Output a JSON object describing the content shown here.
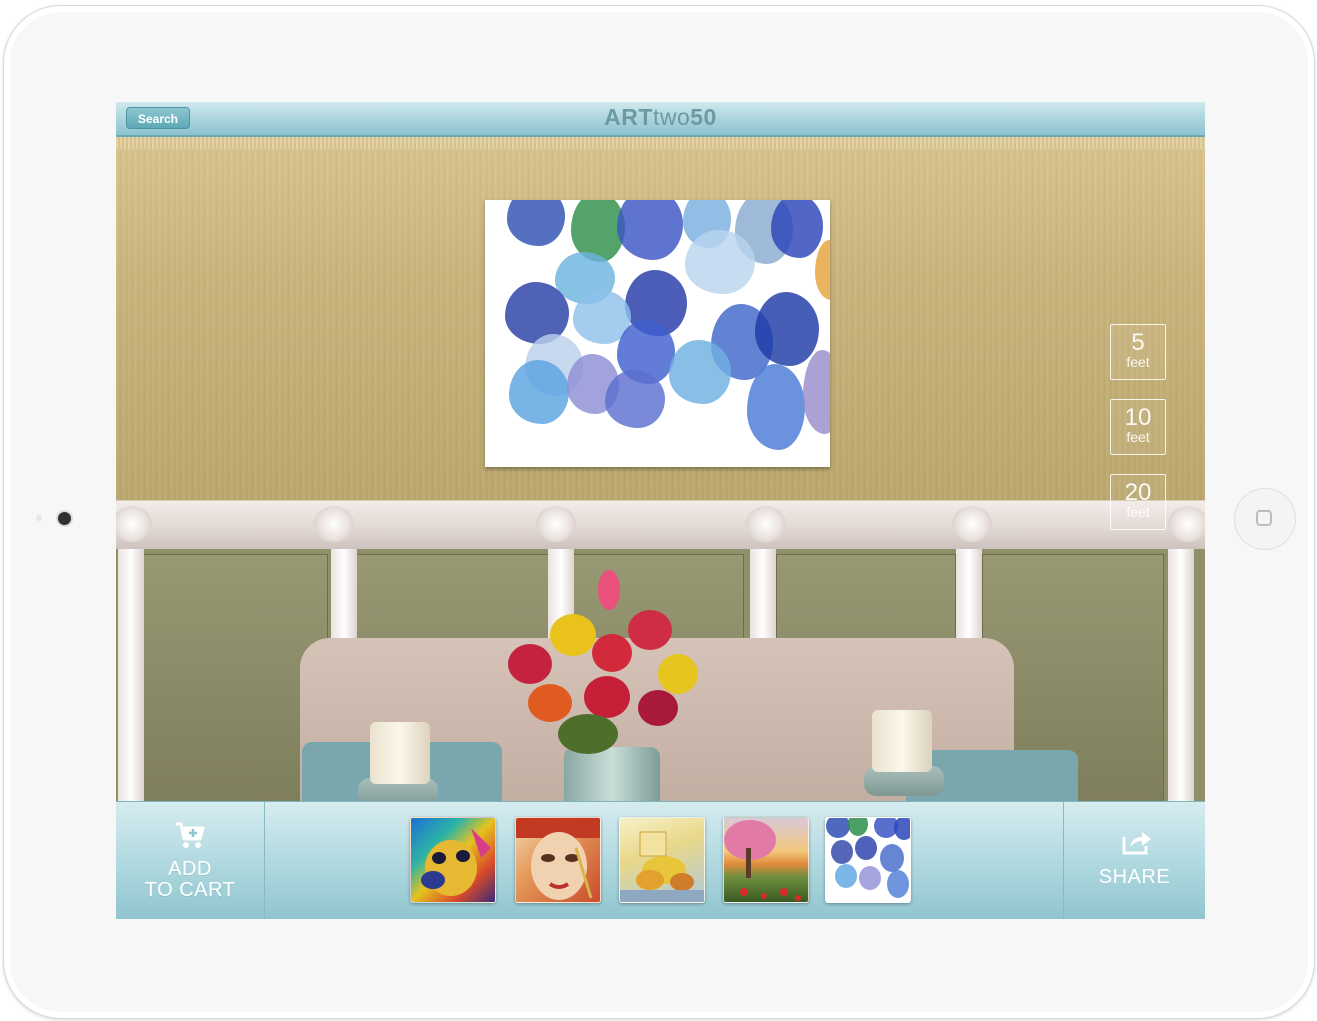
{
  "app": {
    "title_part1": "ART",
    "title_part2": "two",
    "title_part3": "50",
    "search_label": "Search"
  },
  "distance_options": [
    {
      "value": "5",
      "unit": "feet"
    },
    {
      "value": "10",
      "unit": "feet"
    },
    {
      "value": "20",
      "unit": "feet"
    }
  ],
  "toolbar": {
    "add_to_cart_line1": "ADD",
    "add_to_cart_line2": "TO CART",
    "share_label": "SHARE",
    "thumbnails": [
      "dog-portrait-thumbnail",
      "woman-face-thumbnail",
      "still-life-thumbnail",
      "cherry-tree-landscape-thumbnail",
      "blue-watercolor-thumbnail"
    ],
    "selected_thumbnail": "blue-watercolor-thumbnail"
  },
  "colors": {
    "accent_teal": "#8cc3ce",
    "logo_color": "#6a9aa4"
  }
}
